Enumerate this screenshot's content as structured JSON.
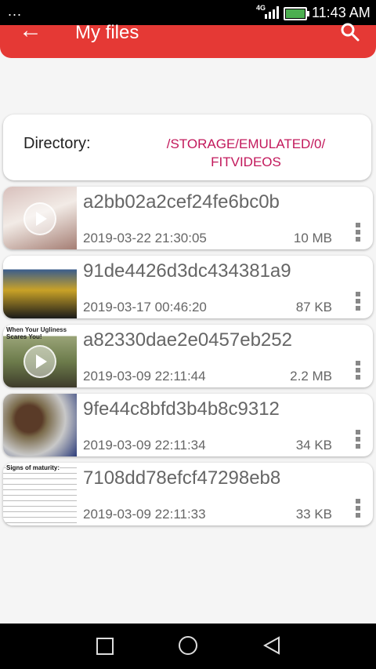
{
  "status_bar": {
    "dots": "...",
    "network": "4G",
    "time": "11:43 AM"
  },
  "app_bar": {
    "back_icon": "arrow-left-icon",
    "title": "My files",
    "search_icon": "search-icon"
  },
  "directory": {
    "label": "Directory:",
    "path": "/STORAGE/EMULATED/0/ FITVIDEOS"
  },
  "files": [
    {
      "name": "a2bb02a2cef24fe6bc0b",
      "date": "2019-03-22 21:30:05",
      "size": "10 MB",
      "has_play": true,
      "thumb_colors": [
        "#c9a9a6",
        "#e8dcd0",
        "#8f6f65"
      ]
    },
    {
      "name": "91de4426d3dc434381a9",
      "date": "2019-03-17 00:46:20",
      "size": "87 KB",
      "has_play": false,
      "thumb_colors": [
        "#c9a227",
        "#1a1a1a",
        "#3a5d8c"
      ]
    },
    {
      "name": "a82330dae2e0457eb252",
      "date": "2019-03-09 22:11:44",
      "size": "2.2 MB",
      "has_play": true,
      "thumb_colors": [
        "#6b7a4a",
        "#9aa478",
        "#3e3b2b"
      ]
    },
    {
      "name": "9fe44c8bfd3b4b8c9312",
      "date": "2019-03-09 22:11:34",
      "size": "34 KB",
      "has_play": false,
      "thumb_colors": [
        "#7a5a3a",
        "#2c3c7a",
        "#c8c8c8"
      ]
    },
    {
      "name": "7108dd78efcf47298eb8",
      "date": "2019-03-09 22:11:33",
      "size": "33 KB",
      "has_play": false,
      "thumb_colors": [
        "#ffffff",
        "#202020",
        "#c62828"
      ]
    }
  ],
  "thumb_captions": {
    "file3": "When Your Ugliness Scares You!",
    "file5": "Signs of maturity:"
  },
  "nav_bar": {
    "recent_icon": "square-icon",
    "home_icon": "circle-icon",
    "back_icon": "triangle-back-icon"
  },
  "colors": {
    "accent": "#e53935",
    "path_text": "#c2185b"
  }
}
